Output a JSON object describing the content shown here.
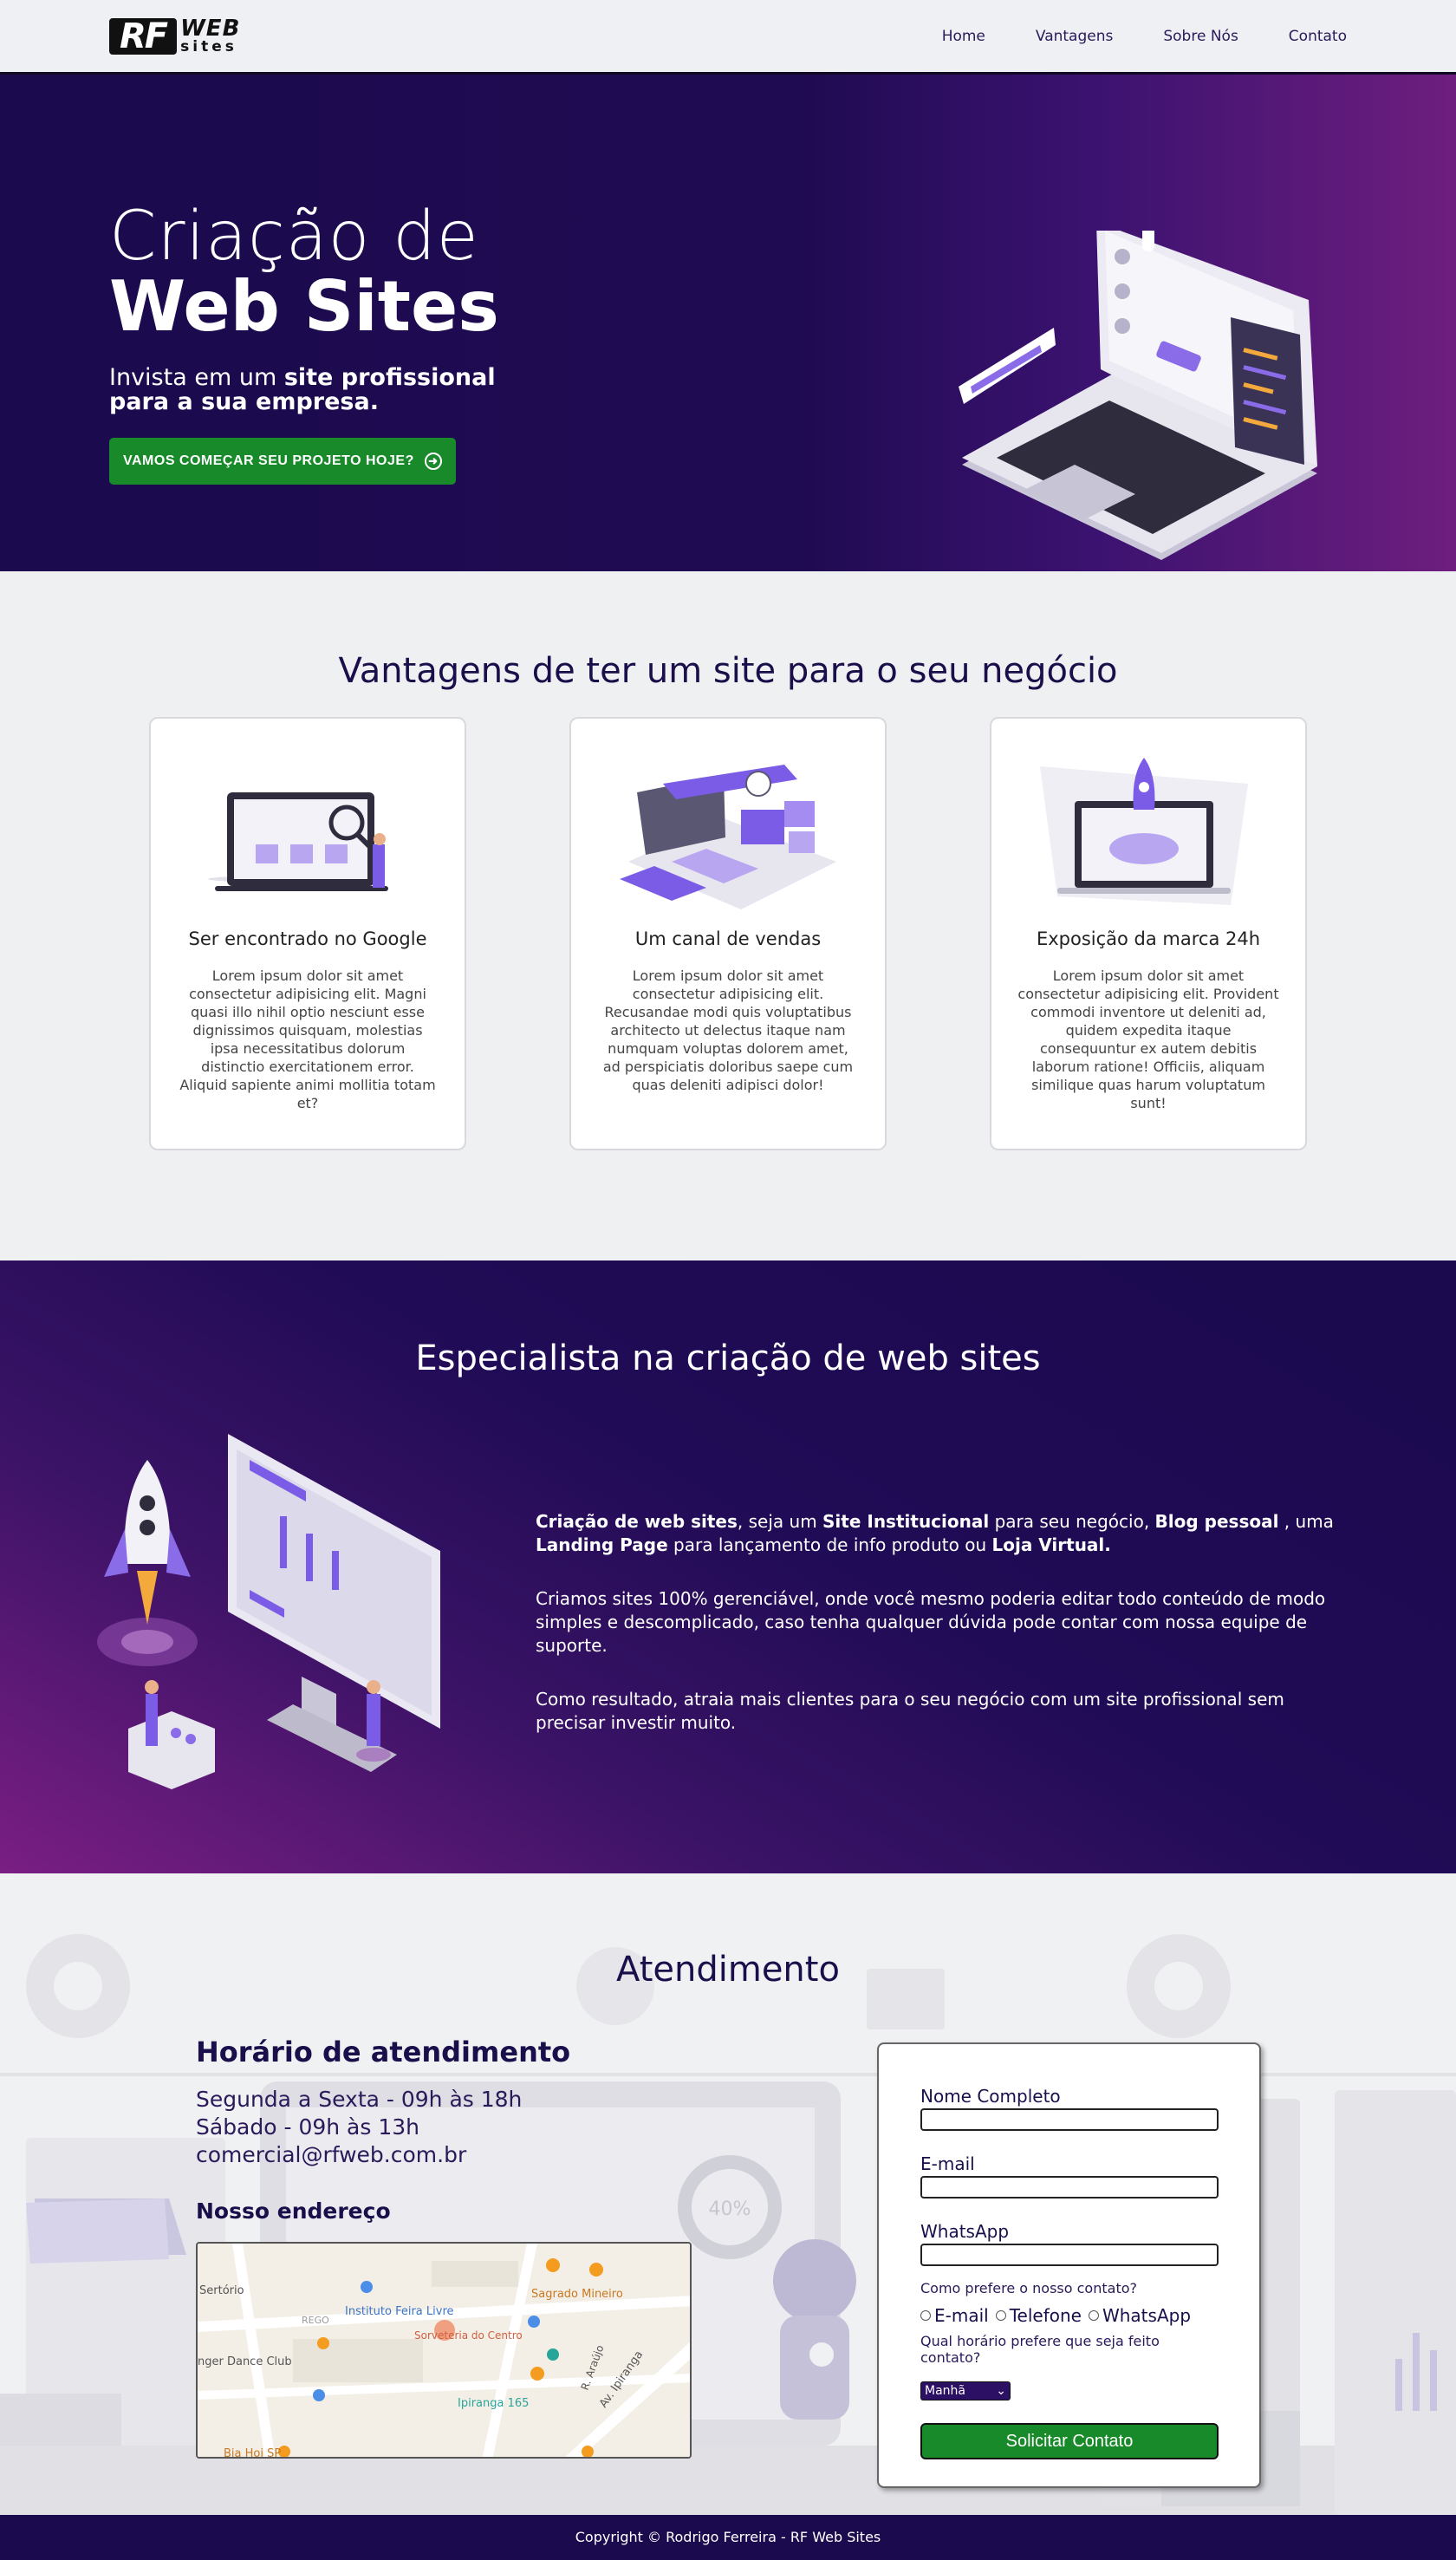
{
  "nav": {
    "logo_rf": "RF",
    "logo_web": "WEB",
    "logo_sites": "sites",
    "items": [
      "Home",
      "Vantagens",
      "Sobre Nós",
      "Contato"
    ]
  },
  "hero": {
    "title_line1": "Criação de",
    "title_line2": "Web Sites",
    "subtitle_pre": "Invista em um ",
    "subtitle_bold": "site profissional para a sua empresa.",
    "cta": "VAMOS COMEÇAR SEU PROJETO HOJE?"
  },
  "advantages": {
    "title": "Vantagens de ter um site para o seu negócio",
    "cards": [
      {
        "title": "Ser encontrado no Google",
        "text": "Lorem ipsum dolor sit amet consectetur adipisicing elit. Magni quasi illo nihil optio nesciunt esse dignissimos quisquam, molestias ipsa necessitatibus dolorum distinctio exercitationem error. Aliquid sapiente animi mollitia totam et?"
      },
      {
        "title": "Um canal de vendas",
        "text": "Lorem ipsum dolor sit amet consectetur adipisicing elit. Recusandae modi quis voluptatibus architecto ut delectus itaque nam numquam voluptas dolorem amet, ad perspiciatis doloribus saepe cum quas deleniti adipisci dolor!"
      },
      {
        "title": "Exposição da marca 24h",
        "text": "Lorem ipsum dolor sit amet consectetur adipisicing elit. Provident commodi inventore ut deleniti ad, quidem expedita itaque consequuntur ex autem debitis laborum ratione! Officiis, aliquam similique quas harum voluptatum sunt!"
      }
    ]
  },
  "specialist": {
    "title": "Especialista na criação de web sites",
    "p1_b1": "Criação de web sites",
    "p1_t1": ", seja um ",
    "p1_b2": "Site Institucional",
    "p1_t2": " para seu negócio, ",
    "p1_b3": "Blog pessoal",
    "p1_t3": " , uma ",
    "p1_b4": "Landing Page",
    "p1_t4": " para lançamento de info produto ou ",
    "p1_b5": "Loja Virtual.",
    "p2": "Criamos sites 100% gerenciável, onde você mesmo poderia editar todo conteúdo de modo simples e descomplicado, caso tenha qualquer dúvida pode contar com nossa equipe de suporte.",
    "p3": "Como resultado, atraia mais clientes para o seu negócio com um site profissional sem precisar investir muito."
  },
  "atendimento": {
    "title": "Atendimento",
    "hours_title": "Horário de atendimento",
    "hours_1": "Segunda a Sexta - 09h às 18h",
    "hours_2": "Sábado - 09h às 13h",
    "email": "comercial@rfweb.com.br",
    "address_title": "Nosso endereço",
    "bg_percent": "40%",
    "map_labels": {
      "l1": "Sertório",
      "l2": "Instituto Feira Livre",
      "l3": "Sagrado Mineiro",
      "l4": "Sorveteria do Centro",
      "l5": "nger Dance Club",
      "l6": "Ipiranga 165",
      "l7": "Av. Ipiranga",
      "l8": "R. Araújo",
      "l9": "Bia Hoi SP",
      "l10": "REGO"
    }
  },
  "form": {
    "name_label": "Nome Completo",
    "email_label": "E-mail",
    "whatsapp_label": "WhatsApp",
    "contact_q": "Como prefere o nosso contato?",
    "opt_email": "E-mail",
    "opt_phone": "Telefone",
    "opt_whatsapp": "WhatsApp",
    "time_q": "Qual horário prefere que seja feito contato?",
    "time_value": "Manhã",
    "submit": "Solicitar Contato"
  },
  "footer": {
    "copyright": "Copyright © Rodrigo Ferreira - RF Web Sites"
  },
  "colors": {
    "brand_dark": "#1b0a4d",
    "brand_purple": "#6e1e7e",
    "accent_green": "#188a2a",
    "illustration_violet": "#7b5ce6"
  }
}
